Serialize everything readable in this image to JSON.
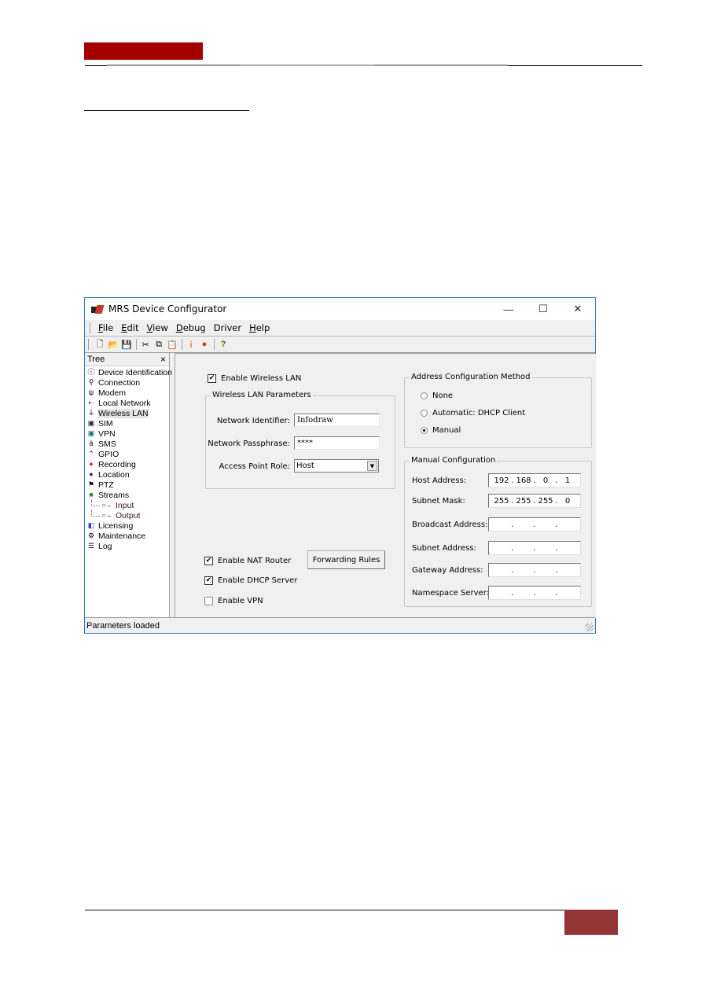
{
  "page": {
    "header_band_color": "#a50000",
    "footer_box_color": "#933535"
  },
  "window": {
    "title": "MRS Device Configurator",
    "controls": {
      "minimize": "—",
      "maximize": "☐",
      "close": "✕"
    },
    "menu": [
      {
        "key": "F",
        "rest": "ile"
      },
      {
        "key": "E",
        "rest": "dit"
      },
      {
        "key": "V",
        "rest": "iew"
      },
      {
        "key": "D",
        "rest": "ebug"
      },
      {
        "key": "",
        "rest": "Driver"
      },
      {
        "key": "H",
        "rest": "elp"
      }
    ],
    "toolbar": [
      {
        "name": "new-file-icon",
        "glyph": "🗋"
      },
      {
        "name": "open-folder-icon",
        "glyph": "📂"
      },
      {
        "name": "save-icon",
        "glyph": "💾"
      },
      {
        "sep": true
      },
      {
        "name": "cut-icon",
        "glyph": "✂"
      },
      {
        "name": "copy-icon",
        "glyph": "⧉"
      },
      {
        "name": "paste-icon",
        "glyph": "📋"
      },
      {
        "sep": true
      },
      {
        "name": "info-icon",
        "glyph": "ⅰ"
      },
      {
        "name": "driver-icon",
        "glyph": "●"
      },
      {
        "sep": true
      },
      {
        "name": "help-icon",
        "glyph": "?"
      }
    ],
    "status": "Parameters loaded"
  },
  "tree": {
    "title": "Tree",
    "close": "×",
    "items": [
      {
        "label": "Device Identification",
        "icon": "info-circle-icon",
        "glyph": "ⓘ",
        "color": "#000"
      },
      {
        "label": "Connection",
        "icon": "connection-icon",
        "glyph": "⚲",
        "color": "#000"
      },
      {
        "label": "Modem",
        "icon": "modem-icon",
        "glyph": "ψ",
        "color": "#000"
      },
      {
        "label": "Local Network",
        "icon": "local-network-icon",
        "glyph": "⇠",
        "color": "#1a2a8a"
      },
      {
        "label": "Wireless LAN",
        "icon": "wireless-lan-icon",
        "glyph": "⏚",
        "color": "#000",
        "selected": true
      },
      {
        "label": "SIM",
        "icon": "sim-icon",
        "glyph": "▣",
        "color": "#222"
      },
      {
        "label": "VPN",
        "icon": "vpn-icon",
        "glyph": "▣",
        "color": "#0b6e77"
      },
      {
        "label": "SMS",
        "icon": "sms-icon",
        "glyph": "ȃ",
        "color": "#000"
      },
      {
        "label": "GPIO",
        "icon": "gpio-icon",
        "glyph": "⌃",
        "color": "#000"
      },
      {
        "label": "Recording",
        "icon": "recording-icon",
        "glyph": "●",
        "color": "#d81f3c"
      },
      {
        "label": "Location",
        "icon": "location-icon",
        "glyph": "●",
        "color": "#25288c"
      },
      {
        "label": "PTZ",
        "icon": "ptz-icon",
        "glyph": "⚑",
        "color": "#000"
      },
      {
        "label": "Streams",
        "icon": "streams-icon",
        "glyph": "■",
        "color": "#2e8b3a"
      },
      {
        "label": "Input",
        "icon": "input-icon",
        "glyph": "○→",
        "color": "#000",
        "child": true
      },
      {
        "label": "Output",
        "icon": "output-icon",
        "glyph": "○→",
        "color": "#000",
        "child": true
      },
      {
        "label": "Licensing",
        "icon": "licensing-icon",
        "glyph": "◧",
        "color": "#2646c4"
      },
      {
        "label": "Maintenance",
        "icon": "maintenance-icon",
        "glyph": "⚙",
        "color": "#000"
      },
      {
        "label": "Log",
        "icon": "log-icon",
        "glyph": "☰",
        "color": "#000"
      }
    ]
  },
  "wlan": {
    "enable_label": "Enable Wireless LAN",
    "enable_checked": true,
    "params_title": "Wireless LAN Parameters",
    "network_id_label": "Network Identifier:",
    "network_id_value": "Infodraw",
    "passphrase_label": "Network Passphrase:",
    "passphrase_value": "****",
    "ap_role_label": "Access Point Role:",
    "ap_role_value": "Host"
  },
  "options": {
    "nat_label": "Enable NAT Router",
    "nat_checked": true,
    "forwarding_button": "Forwarding Rules",
    "dhcp_server_label": "Enable DHCP Server",
    "dhcp_server_checked": true,
    "vpn_label": "Enable VPN",
    "vpn_checked": false
  },
  "address_method": {
    "title": "Address Configuration Method",
    "options": [
      {
        "label": "None",
        "selected": false
      },
      {
        "label": "Automatic: DHCP Client",
        "selected": false
      },
      {
        "label": "Manual",
        "selected": true
      }
    ]
  },
  "manual": {
    "title": "Manual Configuration",
    "fields": [
      {
        "label": "Host Address:",
        "octets": [
          "192",
          "168",
          "0",
          "1"
        ]
      },
      {
        "label": "Subnet Mask:",
        "octets": [
          "255",
          "255",
          "255",
          "0"
        ]
      },
      {
        "label": "Broadcast Address:",
        "octets": [
          "",
          "",
          "",
          ""
        ]
      },
      {
        "label": "Subnet Address:",
        "octets": [
          "",
          "",
          "",
          ""
        ]
      },
      {
        "label": "Gateway Address:",
        "octets": [
          "",
          "",
          "",
          ""
        ]
      },
      {
        "label": "Namespace Server:",
        "octets": [
          "",
          "",
          "",
          ""
        ]
      }
    ]
  }
}
